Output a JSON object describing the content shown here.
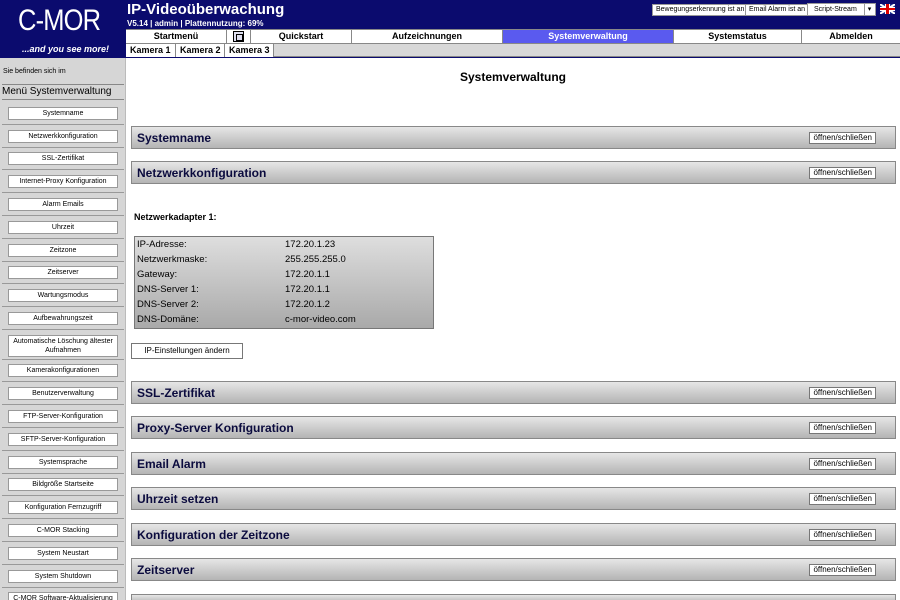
{
  "header": {
    "logo_text": "C-MOR",
    "logo_tagline": "...and you see more!",
    "title": "IP-Videoüberwachung",
    "subtitle": "V5.14 | admin | Plattennutzung: 69%",
    "motion_button": "Bewegungserkennung ist an",
    "email_button": "Email Alarm ist an",
    "stream_select": "Script-Stream",
    "flag_icon": "uk-flag-icon"
  },
  "nav": {
    "tabs": [
      {
        "label": "Startmenü"
      },
      {
        "label": "Quickstart"
      },
      {
        "label": "Aufzeichnungen"
      },
      {
        "label": "Systemverwaltung"
      },
      {
        "label": "Systemstatus"
      },
      {
        "label": "Abmelden"
      }
    ],
    "active_color": "#5a5aef",
    "cameras": [
      "Kamera 1",
      "Kamera 2",
      "Kamera 3"
    ]
  },
  "sidebar": {
    "breadcrumb": "Sie befinden sich im",
    "menu_title": "Menü Systemverwaltung",
    "items": [
      "Systemname",
      "Netzwerkkonfiguration",
      "SSL-Zertifikat",
      "Internet-Proxy Konfiguration",
      "Alarm Emails",
      "Uhrzeit",
      "Zeitzone",
      "Zeitserver",
      "Wartungsmodus",
      "Aufbewahrungszeit",
      "Automatische Löschung ältester Aufnahmen",
      "Kamerakonfigurationen",
      "Benutzerverwaltung",
      "FTP-Server-Konfiguration",
      "SFTP-Server-Konfiguration",
      "Systemsprache",
      "Bildgröße Startseite",
      "Konfiguration Fernzugriff",
      "C-MOR Stacking",
      "System Neustart",
      "System Shutdown",
      "C-MOR Software-Aktualisierung"
    ]
  },
  "main": {
    "page_title": "Systemverwaltung",
    "toggle_label": "öffnen/schließen",
    "sections": [
      "Systemname",
      "Netzwerkkonfiguration",
      "SSL-Zertifikat",
      "Proxy-Server Konfiguration",
      "Email Alarm",
      "Uhrzeit setzen",
      "Konfiguration der Zeitzone",
      "Zeitserver"
    ],
    "adapter_title": "Netzwerkadapter 1:",
    "ip_rows": [
      {
        "key": "IP-Adresse:",
        "value": "172.20.1.23"
      },
      {
        "key": "Netzwerkmaske:",
        "value": "255.255.255.0"
      },
      {
        "key": "Gateway:",
        "value": "172.20.1.1"
      },
      {
        "key": "DNS-Server 1:",
        "value": "172.20.1.1"
      },
      {
        "key": "DNS-Server 2:",
        "value": "172.20.1.2"
      },
      {
        "key": "DNS-Domäne:",
        "value": "c-mor-video.com"
      }
    ],
    "ip_change_button": "IP-Einstellungen ändern"
  }
}
